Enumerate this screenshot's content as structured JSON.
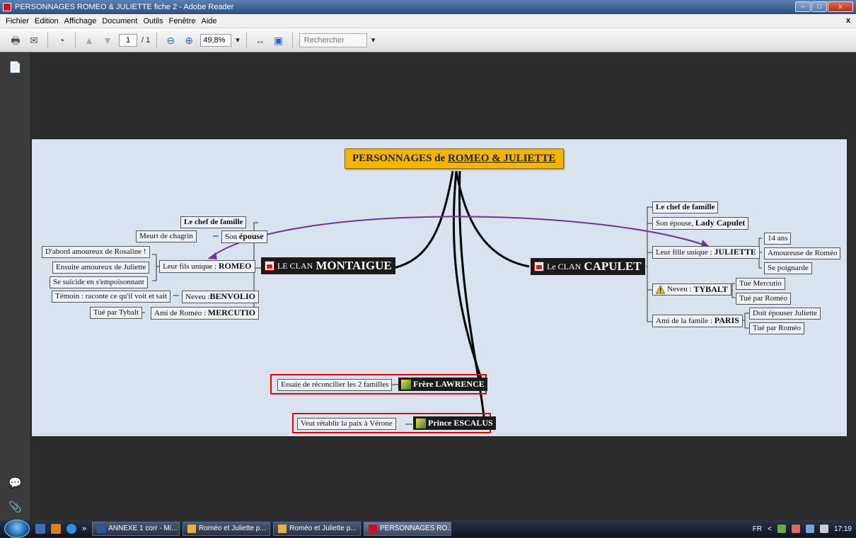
{
  "window": {
    "title": "PERSONNAGES ROMEO & JULIETTE fiche 2 - Adobe Reader",
    "controls": [
      "–",
      "□",
      "x"
    ]
  },
  "menu": {
    "items": [
      "Fichier",
      "Edition",
      "Affichage",
      "Document",
      "Outils",
      "Fenêtre",
      "Aide"
    ],
    "close": "x"
  },
  "toolbar": {
    "page_current": "1",
    "page_total": "/ 1",
    "zoom": "49,8%",
    "search_placeholder": "Rechercher"
  },
  "mindmap": {
    "central": {
      "prefix": "PERSONNAGES de ",
      "title": "ROMEO & JULIETTE"
    },
    "montaigue": {
      "clan_prefix": "LE CLAN ",
      "clan_name": "MONTAIGUE",
      "chef": "Le chef de famille",
      "epouse_prefix": "Son ",
      "epouse_bold": "épouse",
      "epouse_detail": "Meurt de chagrin",
      "fils_prefix": "Leur fils unique : ",
      "fils_name": "ROMEO",
      "fils_details": [
        "D'abord amoureux de Rosaline !",
        "Ensuite amoureux de Juliette",
        "Se suicide en s'empoisonnant"
      ],
      "neveu_prefix": "Neveu :",
      "neveu_name": "BENVOLIO",
      "neveu_detail": "Témoin : raconte ce qu'il voit et sait",
      "ami_prefix": "Ami de Roméo : ",
      "ami_name": "MERCUTIO",
      "ami_detail": "Tué par Tybalt"
    },
    "capulet": {
      "clan_prefix": "Le CLAN ",
      "clan_name": "CAPULET",
      "chef": "Le chef de famille",
      "epouse_prefix": "Son épouse, ",
      "epouse_name": "Lady Capulet",
      "fille_prefix": "Leur fille unique : ",
      "fille_name": "JULIETTE",
      "fille_details": [
        "14 ans",
        "Amoureuse de Roméo",
        "Se poignarde"
      ],
      "neveu_prefix": "Neveu : ",
      "neveu_name": "TYBALT",
      "neveu_details": [
        "Tue Mercutio",
        "Tué par Roméo"
      ],
      "ami_prefix": "Ami de la famile : ",
      "ami_name": "PARIS",
      "ami_details": [
        "Doit épouser Juliette",
        "Tué par Roméo"
      ]
    },
    "lawrence": {
      "name": "Frère LAWRENCE",
      "detail": "Essaie de réconcilier les 2 familles"
    },
    "escalus": {
      "name": "Prince ESCALUS",
      "detail": "Veut rétablir la paix à Vérone"
    }
  },
  "taskbar": {
    "chevron": "»",
    "buttons": [
      "ANNEXE 1 corr - Mi...",
      "Roméo et Juliette  p...",
      "Roméo et Juliette  p...",
      "PERSONNAGES RO..."
    ],
    "lang": "FR",
    "tray_arrow": "<",
    "time": "17:19"
  },
  "colors": {
    "page_bg": "#d9e3ef",
    "central_bg": "#f5b400",
    "relation_arrow": "#7030a0",
    "highlight": "#e00000"
  }
}
